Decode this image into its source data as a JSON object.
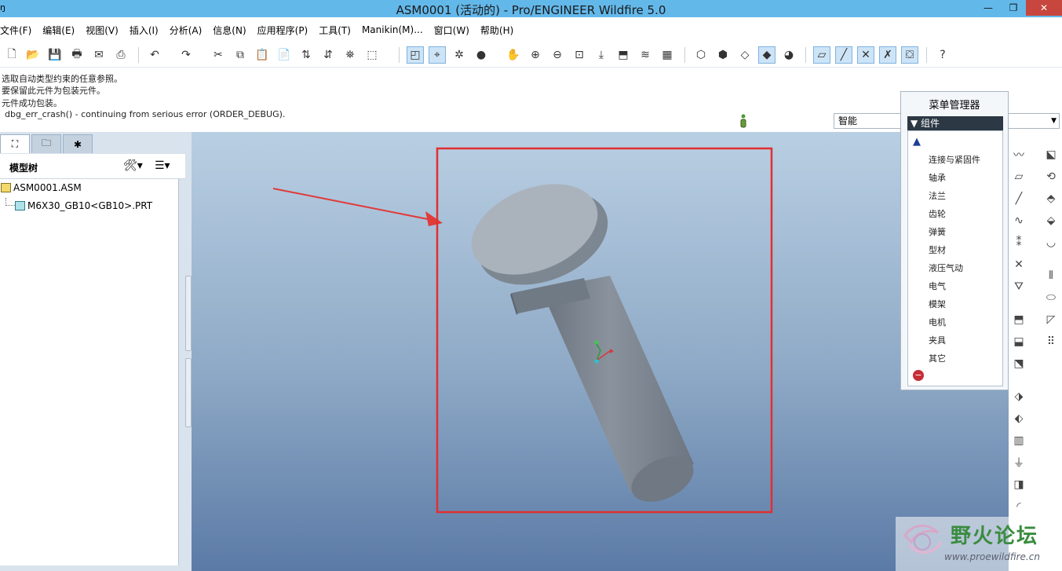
{
  "window": {
    "title": "ASM0001 (活动的) - Pro/ENGINEER Wildfire 5.0",
    "app_icon_label": "ŋ",
    "minimize_label": "—",
    "maximize_label": "❐",
    "close_label": "✕"
  },
  "menubar": {
    "items": [
      "文件(F)",
      "编辑(E)",
      "视图(V)",
      "插入(I)",
      "分析(A)",
      "信息(N)",
      "应用程序(P)",
      "工具(T)",
      "Manikin(M)...",
      "窗口(W)",
      "帮助(H)"
    ]
  },
  "messages": [
    "选取自动类型约束的任意参照。",
    "要保留此元件为包装元件。",
    "元件成功包装。",
    "dbg_err_crash() - continuing from serious error (ORDER_DEBUG)."
  ],
  "filter": {
    "selected": "智能"
  },
  "model_tree": {
    "title": "模型树",
    "items": [
      {
        "label": "ASM0001.ASM"
      },
      {
        "label": "M6X30_GB10<GB10>.PRT"
      }
    ]
  },
  "menu_manager": {
    "title": "菜单管理器",
    "header": "组件",
    "items": [
      "连接与紧固件",
      "轴承",
      "法兰",
      "齿轮",
      "弹簧",
      "型材",
      "液压气动",
      "电气",
      "模架",
      "电机",
      "夹具",
      "其它"
    ]
  },
  "watermark": {
    "name": "野火论坛",
    "url": "www.proewildfire.cn"
  },
  "colors": {
    "titlebar": "#63b8ea",
    "highlight_box": "#e03030",
    "arrow": "#e03a3a",
    "part": "#7f8a96"
  }
}
